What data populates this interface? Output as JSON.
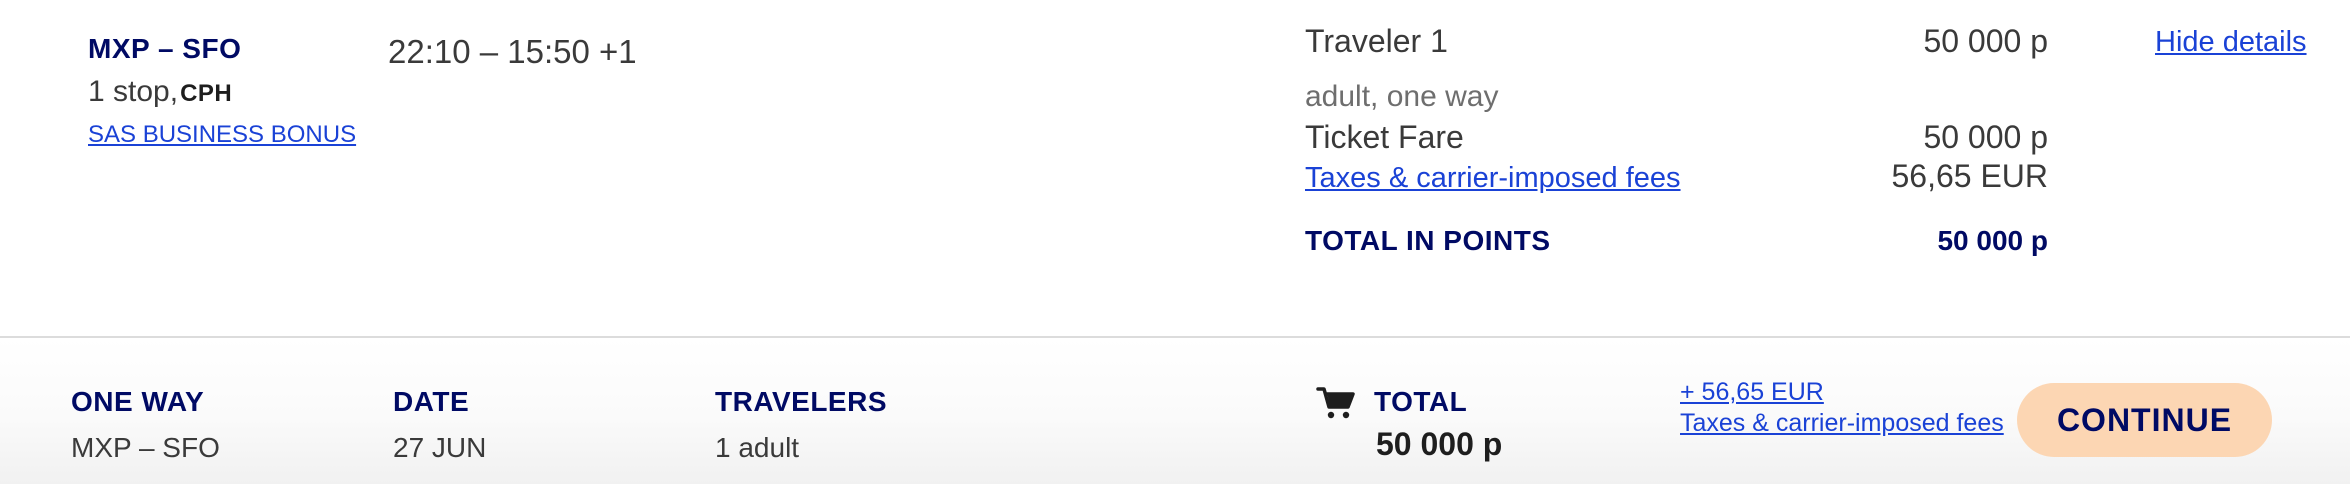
{
  "flight": {
    "route": "MXP – SFO",
    "stops": "1 stop,",
    "stop_code": "CPH",
    "fare_brand": "SAS BUSINESS BONUS",
    "times": "22:10 – 15:50 +1"
  },
  "details": {
    "traveler_label": "Traveler 1",
    "traveler_points": "50 000 p",
    "hide_details": "Hide details",
    "traveler_type": "adult, one way",
    "ticket_fare_label": "Ticket Fare",
    "ticket_fare_value": "50 000 p",
    "taxes_label": "Taxes & carrier-imposed fees",
    "taxes_value": "56,65 EUR",
    "total_label": "TOTAL IN POINTS",
    "total_value": "50 000 p"
  },
  "summary": {
    "trip_type_label": "ONE WAY",
    "trip_type_value": "MXP – SFO",
    "date_label": "DATE",
    "date_value": "27 JUN",
    "travelers_label": "TRAVELERS",
    "travelers_value": "1 adult",
    "cart_icon": "shopping-cart-icon",
    "total_label": "TOTAL",
    "total_value": "50 000 p",
    "fees_amount": "+ 56,65 EUR",
    "fees_label": "Taxes & carrier-imposed fees",
    "continue_label": "CONTINUE"
  },
  "colors": {
    "navy": "#000a64",
    "link": "#1a42d6",
    "continue_bg": "#fcd6b3"
  }
}
